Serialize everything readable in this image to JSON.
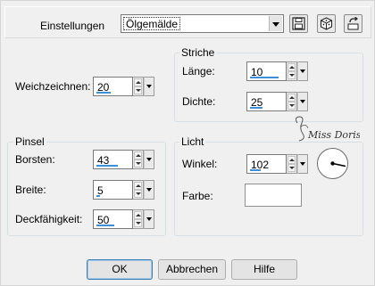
{
  "header": {
    "settings_label": "Einstellungen",
    "preset_value": "Ölgemälde"
  },
  "toolbar": {
    "save_icon": "save-icon",
    "randomize_icon": "dice-icon",
    "reset_icon": "reset-icon"
  },
  "blur": {
    "label": "Weichzeichnen:",
    "value": "20"
  },
  "strokes": {
    "title": "Striche",
    "length_label": "Länge:",
    "length_value": "10",
    "density_label": "Dichte:",
    "density_value": "25"
  },
  "brush": {
    "title": "Pinsel",
    "bristles_label": "Borsten:",
    "bristles_value": "43",
    "width_label": "Breite:",
    "width_value": "5",
    "opacity_label": "Deckfähigkeit:",
    "opacity_value": "50"
  },
  "light": {
    "title": "Licht",
    "angle_label": "Winkel:",
    "angle_value": "102",
    "color_label": "Farbe:",
    "color_value": "#ffffff"
  },
  "watermark": {
    "text": "Miss Doris"
  },
  "footer": {
    "ok_label": "OK",
    "cancel_label": "Abbrechen",
    "help_label": "Hilfe"
  }
}
